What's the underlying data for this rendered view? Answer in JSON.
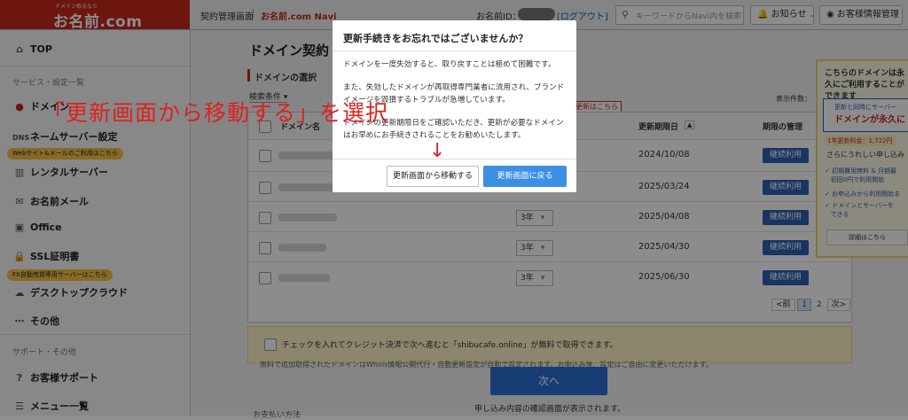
{
  "header": {
    "logo_tag": "ドメイン取るなら",
    "logo_main": "お名前.com",
    "breadcrumb_contract": "契約管理画面",
    "breadcrumb_sep": "|",
    "breadcrumb_navi": "お名前.com Navi",
    "id_label": "お名前ID：",
    "logout": "[ログアウト]",
    "search_placeholder": "キーワードからNavi内を検索",
    "notice": "お知らせ",
    "customer_info": "お客様情報管理"
  },
  "sidebar": {
    "top": "TOP",
    "section_services": "サービス・設定一覧",
    "domain": "ドメイン",
    "nameserver": "ネームサーバー設定",
    "badge_web": "Webサイト&メールのご利用はこちら",
    "rental_server": "レンタルサーバー",
    "mail": "お名前メール",
    "office": "Office",
    "ssl": "SSL証明書",
    "badge_fx": "FX自動売買専用サーバーはこちら",
    "desktop_cloud": "デスクトップクラウド",
    "other": "その他",
    "section_support": "サポート・その他",
    "support": "お客様サポート",
    "menu_list": "メニュー一覧"
  },
  "main": {
    "page_title": "ドメイン契約",
    "section_title": "ドメインの選択",
    "search_filter": "検索条件",
    "display_count": "表示件数：",
    "col_domain": "ドメイン名",
    "col_expiry": "更新期限日",
    "col_manage": "期限の管理",
    "renew_link": "更新はこちら",
    "renew_button": "継続利用",
    "rows": [
      {
        "years": "",
        "expiry": "2024/10/08"
      },
      {
        "years": "",
        "expiry": "2025/03/24"
      },
      {
        "years": "3年",
        "expiry": "2025/04/08"
      },
      {
        "years": "3年",
        "expiry": "2025/04/30"
      },
      {
        "years": "3年",
        "expiry": "2025/06/30"
      }
    ],
    "pagination": {
      "prev": "<前",
      "page1": "1",
      "page2": "2",
      "next": "次>"
    },
    "credit_check": "チェックを入れてクレジット決済で次へ進むと「shibucafe.online」が無料で取得できます。",
    "whois_note": "無料で追加取得されたドメインはWhois情報公開代行・自動更新設定が自動で設定されます。お申込み後、設定はご自由に変更いただけます。",
    "next_button": "次へ",
    "confirm_note": "申し込み内容の確認画面が表示されます。",
    "payment_label": "お支払い方法"
  },
  "right_panel": {
    "heading": "こちらのドメインは永久にご利用することができます",
    "bubble1": "更新と同時にサーバー",
    "bubble2": "ドメインが永久に",
    "price": "1年更新料金：1,722円",
    "sub": "さらにうれしい申し込み",
    "b1": "初期費用無料 & 月額最",
    "b1b": "初回0円で利用開始",
    "b2": "お申込みから利用開始ま",
    "b3": "ドメインとサーバーを",
    "b3b": "できる",
    "details": "詳細はこちら"
  },
  "modal": {
    "title": "更新手続きをお忘れではございませんか？",
    "p1": "ドメインを一度失効すると、取り戻すことは極めて困難です。",
    "p2": "また、失効したドメインが再取得専門業者に流用され、ブランドイメージを毀損するトラブルが急増しています。",
    "p3": "ドメインの更新期限日をご確認いただき、更新が必要なドメインはお早めにお手続きされることをお勧めいたします。",
    "btn_move": "更新画面から移動する",
    "btn_back": "更新画面に戻る"
  },
  "annotation": {
    "text": "「更新画面から移動する」を選択",
    "arrow": "↓"
  },
  "colors": {
    "brand_red": "#c5281c",
    "renew_blue": "#2d5fb5",
    "modal_primary": "#3d8fe6",
    "annotation_red": "#e02020",
    "badge_yellow": "#f6c244"
  }
}
